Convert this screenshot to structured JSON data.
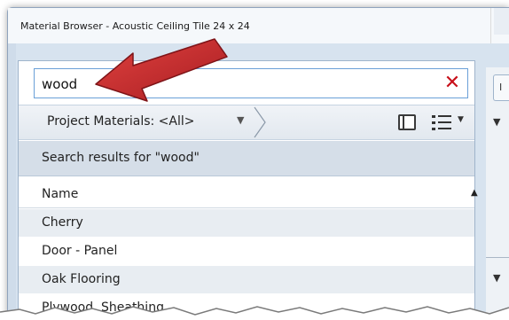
{
  "window": {
    "title": "Material Browser - Acoustic Ceiling Tile 24 x 24"
  },
  "search": {
    "value": "wood",
    "clear_icon": "close-x-icon",
    "clear_color": "#c8101a"
  },
  "toolbar": {
    "filter_label": "Project Materials: <All>",
    "panel_icon": "panel-toggle-icon",
    "list_icon": "list-view-icon"
  },
  "results": {
    "header": "Search results for \"wood\""
  },
  "table": {
    "column": "Name",
    "rows": [
      "Cherry",
      "Door - Panel",
      "Oak Flooring",
      "Plywood, Sheathing"
    ]
  },
  "right_panel": {
    "tab_label": "I"
  },
  "annotation": {
    "arrow_color": "#c0272d"
  }
}
